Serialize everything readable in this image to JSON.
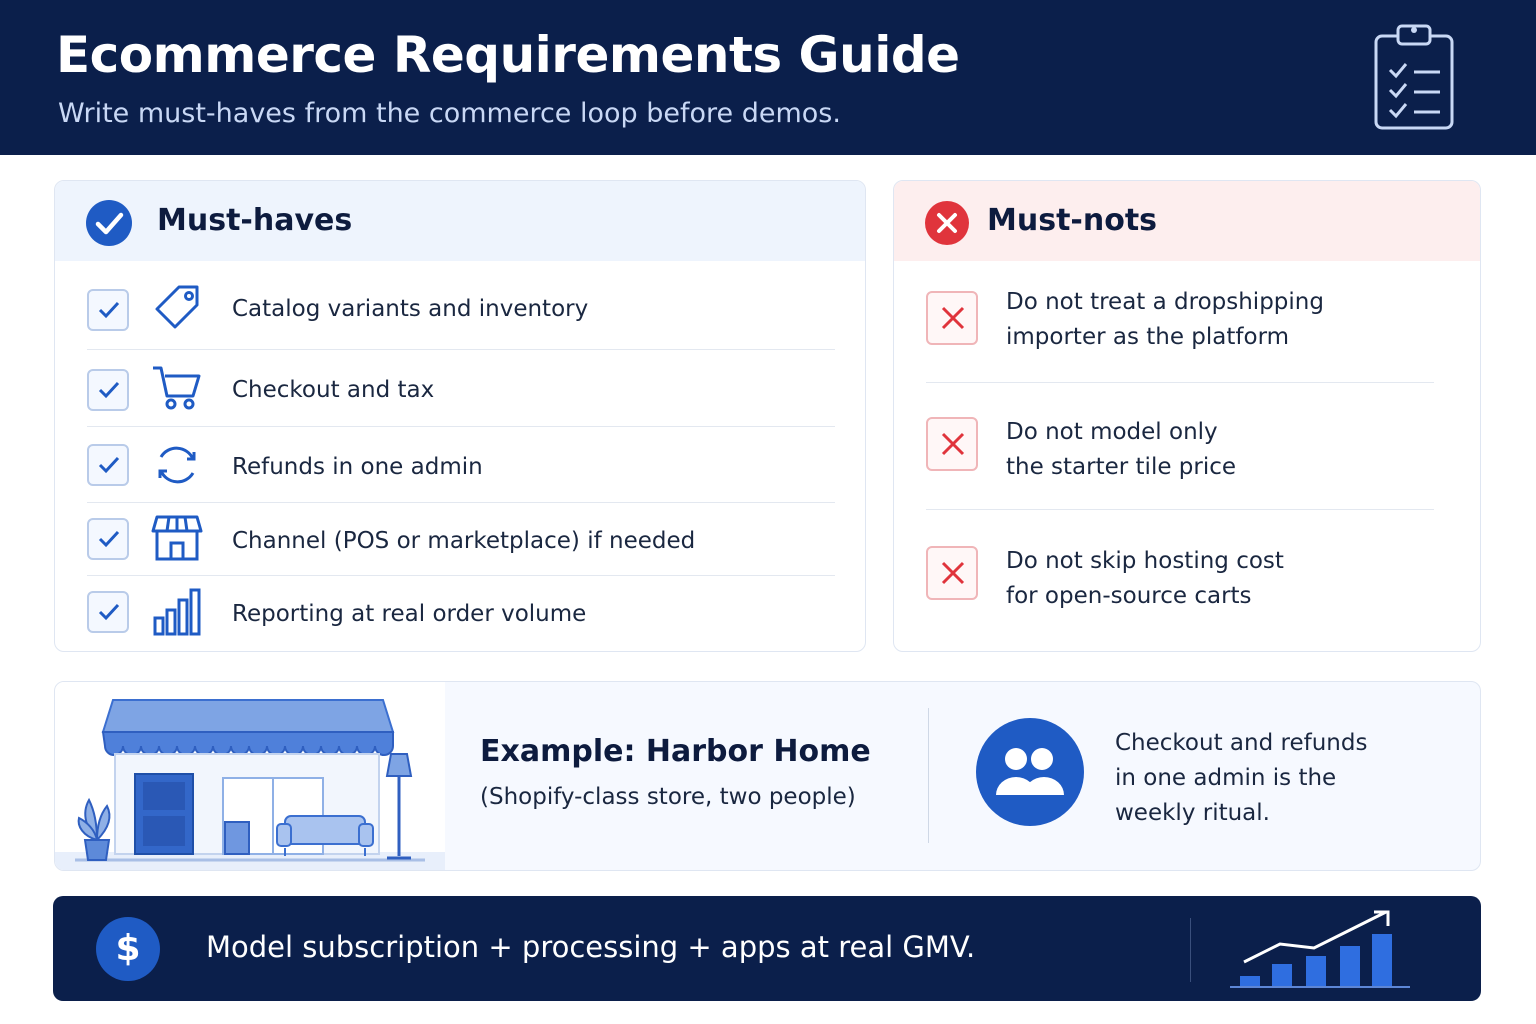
{
  "header": {
    "title": "Ecommerce Requirements Guide",
    "subtitle": "Write must-haves from the commerce loop before demos."
  },
  "must_haves": {
    "title": "Must-haves",
    "items": [
      {
        "label": "Catalog variants and inventory",
        "icon": "price-tag-icon"
      },
      {
        "label": "Checkout and tax",
        "icon": "shopping-cart-icon"
      },
      {
        "label": "Refunds in one admin",
        "icon": "refresh-icon"
      },
      {
        "label": "Channel (POS or marketplace) if needed",
        "icon": "storefront-icon"
      },
      {
        "label": "Reporting at real order volume",
        "icon": "bar-chart-icon"
      }
    ]
  },
  "must_nots": {
    "title": "Must-nots",
    "items": [
      {
        "line1": "Do not treat a dropshipping",
        "line2": "importer as the platform"
      },
      {
        "line1": "Do not model only",
        "line2": "the starter tile price"
      },
      {
        "line1": "Do not skip hosting cost",
        "line2": "for open-source carts"
      }
    ]
  },
  "example": {
    "title": "Example: Harbor Home",
    "subtitle": "(Shopify-class store, two people)",
    "note_lines": [
      "Checkout and refunds",
      "in one admin is the",
      "weekly ritual."
    ]
  },
  "footer": {
    "symbol": "$",
    "text": "Model subscription + processing + apps at real GMV."
  },
  "colors": {
    "navy": "#0b1f4b",
    "accent_blue": "#1f5bc4",
    "alert_red": "#e0343c"
  }
}
